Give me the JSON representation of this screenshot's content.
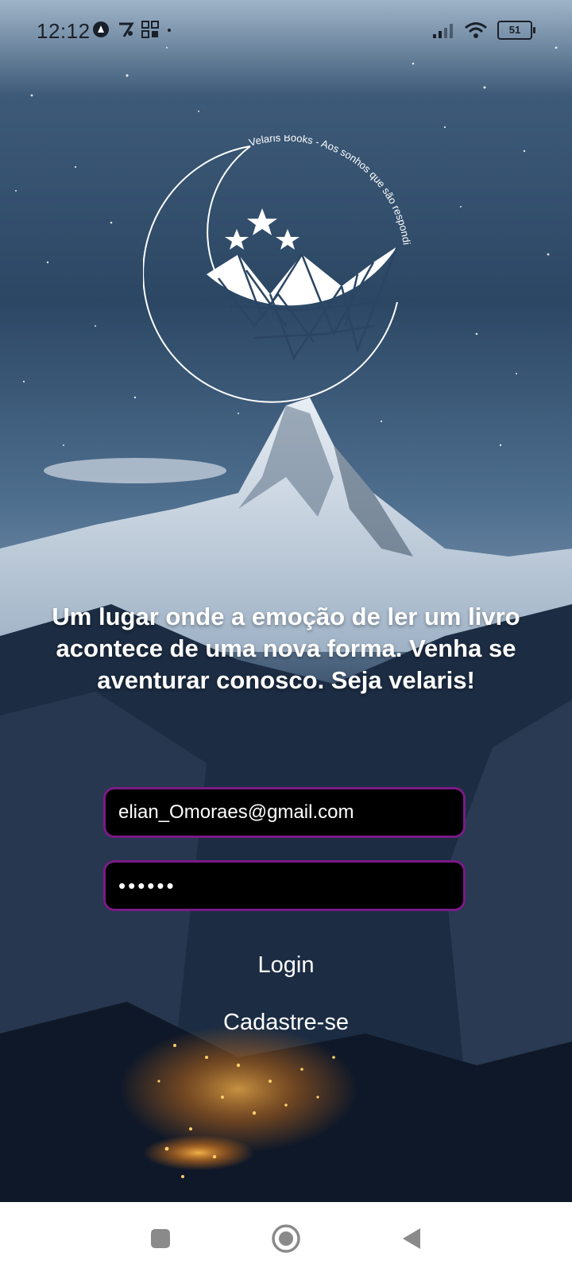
{
  "status_bar": {
    "time": "12:12",
    "battery_level": "51"
  },
  "logo": {
    "arc_text": "Velaris Books - Aos sonhos que são respondidos"
  },
  "tagline": "Um lugar onde a emoção de ler um livro acontece de uma nova forma. Venha se aventurar conosco. Seja velaris!",
  "login_form": {
    "email_value": "elian_Omoraes@gmail.com",
    "password_value": "••••••",
    "login_label": "Login",
    "signup_label": "Cadastre-se"
  },
  "colors": {
    "field_border": "#7a1a86",
    "field_background": "#000000",
    "text": "#ffffff"
  },
  "nav_bar": {
    "icons": [
      "recent-apps-icon",
      "home-icon",
      "back-icon"
    ]
  }
}
